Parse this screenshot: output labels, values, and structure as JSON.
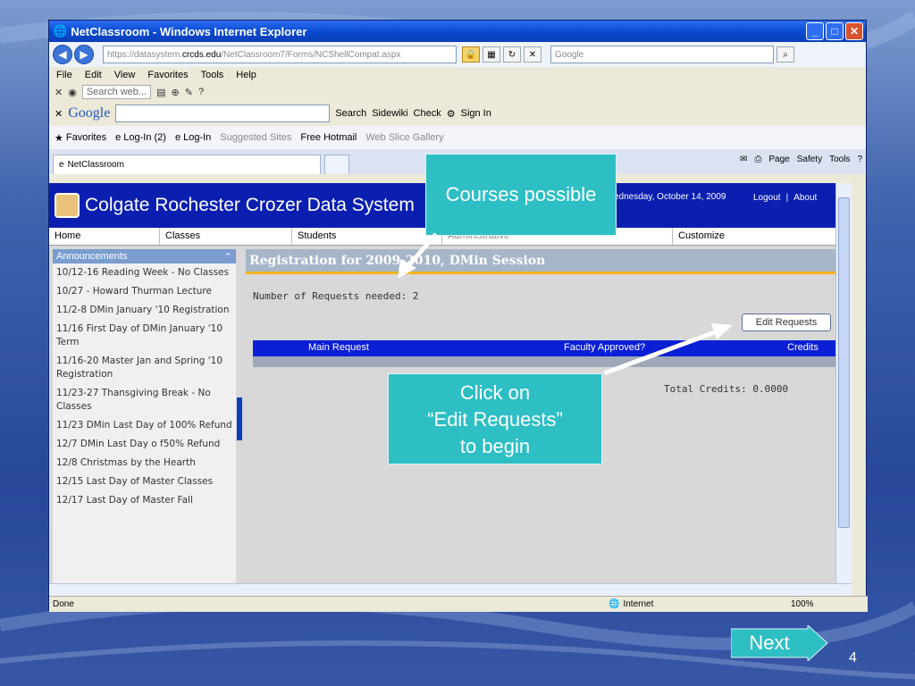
{
  "window": {
    "title": "NetClassroom - Windows Internet Explorer",
    "controls": [
      "minimize",
      "maximize",
      "close"
    ]
  },
  "address": {
    "url_prefix": "https://datasystem.",
    "url_domain": "crcds.edu",
    "url_path": "/NetClassroom7/Forms/NCShellCompat.aspx",
    "search_placeholder": "Google"
  },
  "menu": [
    "File",
    "Edit",
    "View",
    "Favorites",
    "Tools",
    "Help"
  ],
  "toolbar": {
    "search_web": "Search web..."
  },
  "google_toolbar": {
    "logo": "Google",
    "items": [
      "Search",
      "Sidewiki",
      "Check",
      "Sign In"
    ]
  },
  "favorites": {
    "label": "Favorites",
    "items": [
      "Log-In (2)",
      "Log-In",
      "Suggested Sites",
      "Free Hotmail",
      "Web Slice Gallery"
    ]
  },
  "tab": {
    "title": "NetClassroom"
  },
  "commands": [
    "Page",
    "Safety",
    "Tools"
  ],
  "site": {
    "title": "Colgate Rochester Crozer Data System",
    "date": "ednesday, October 14, 2009",
    "links": [
      "Logout",
      "|",
      "About"
    ]
  },
  "nav": [
    "Home",
    "Classes",
    "Students",
    "Administrative",
    "Customize"
  ],
  "announcements": {
    "header": "Announcements",
    "items": [
      "10/12-16 Reading Week - No Classes",
      "10/27 - Howard Thurman Lecture",
      "11/2-8 DMin January '10 Registration",
      "11/16 First Day of DMin January '10 Term",
      "11/16-20 Master Jan and Spring '10 Registration",
      "11/23-27 Thansgiving Break - No Classes",
      "11/23 DMin Last Day of 100% Refund",
      "12/7 DMin Last Day o f50% Refund",
      "12/8 Christmas by the Hearth",
      "12/15 Last Day of Master Classes",
      "12/17 Last Day of Master Fall"
    ]
  },
  "registration": {
    "header": "Registration for 2009-2010, DMin Session",
    "requests_needed": "Number of Requests needed: 2",
    "edit_button": "Edit Requests",
    "columns": [
      "Main Request",
      "Faculty Approved?",
      "Credits"
    ],
    "total_credits": "Total Credits:  0.0000"
  },
  "status": {
    "text": "Done",
    "zone": "Internet",
    "zoom": "100%"
  },
  "callouts": {
    "courses": "Courses possible",
    "click_line1": "Click on",
    "click_line2": "“Edit Requests”",
    "click_line3": "to begin"
  },
  "slide": {
    "next": "Next",
    "page": "4"
  },
  "colors": {
    "callout": "#2dbfc4",
    "site_header": "#0a1fb0",
    "accent_stripe": "#f6b21c"
  }
}
